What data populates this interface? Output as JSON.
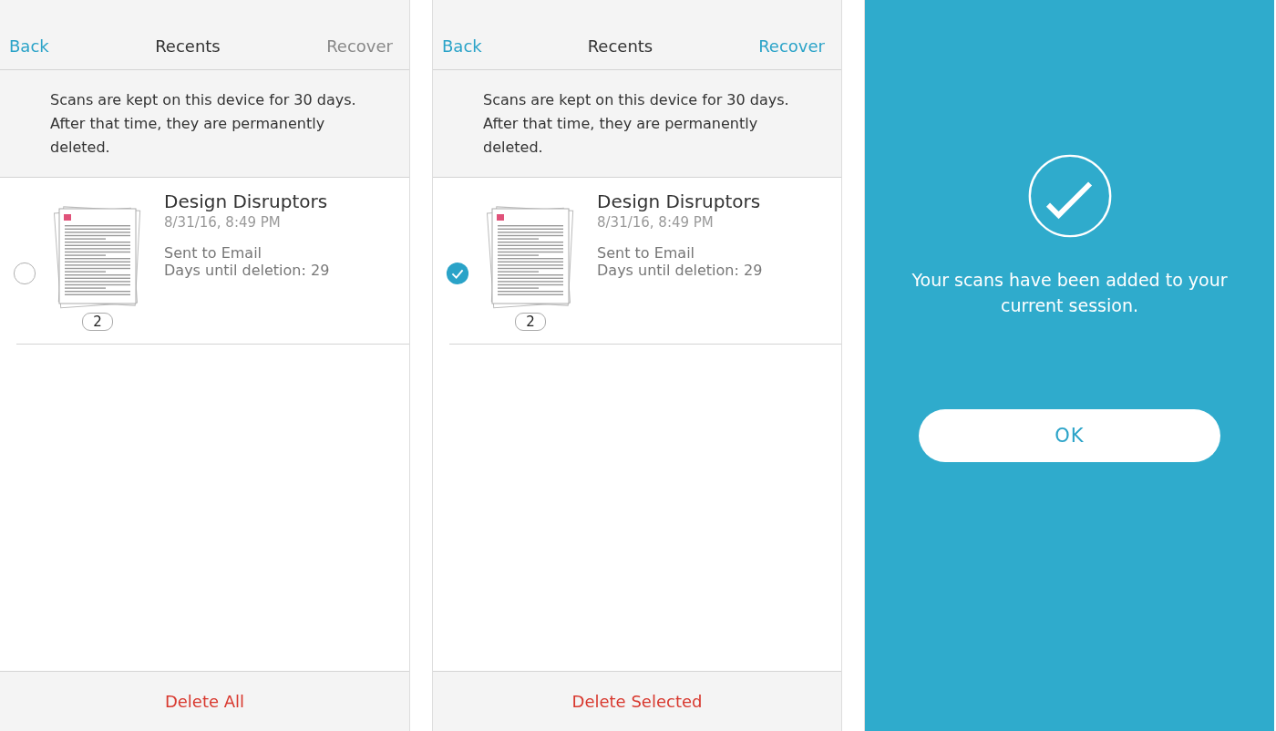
{
  "screens": [
    {
      "header": {
        "back": "Back",
        "title": "Recents",
        "recover": "Recover",
        "recover_enabled": false
      },
      "notice": "Scans are kept on this device for 30 days. After that time, they are permanently deleted.",
      "items": [
        {
          "title": "Design Disruptors",
          "date": "8/31/16, 8:49 PM",
          "status": "Sent to Email",
          "days": "Days until deletion: 29",
          "pages": "2",
          "selected": false
        }
      ],
      "footer": "Delete All"
    },
    {
      "header": {
        "back": "Back",
        "title": "Recents",
        "recover": "Recover",
        "recover_enabled": true
      },
      "notice": "Scans are kept on this device for 30 days. After that time, they are permanently deleted.",
      "items": [
        {
          "title": "Design Disruptors",
          "date": "8/31/16, 8:49 PM",
          "status": "Sent to Email",
          "days": "Days until deletion: 29",
          "pages": "2",
          "selected": true
        }
      ],
      "footer": "Delete Selected"
    },
    {
      "overlay": {
        "message": "Your scans have been added to your current session.",
        "button": "OK"
      }
    }
  ]
}
